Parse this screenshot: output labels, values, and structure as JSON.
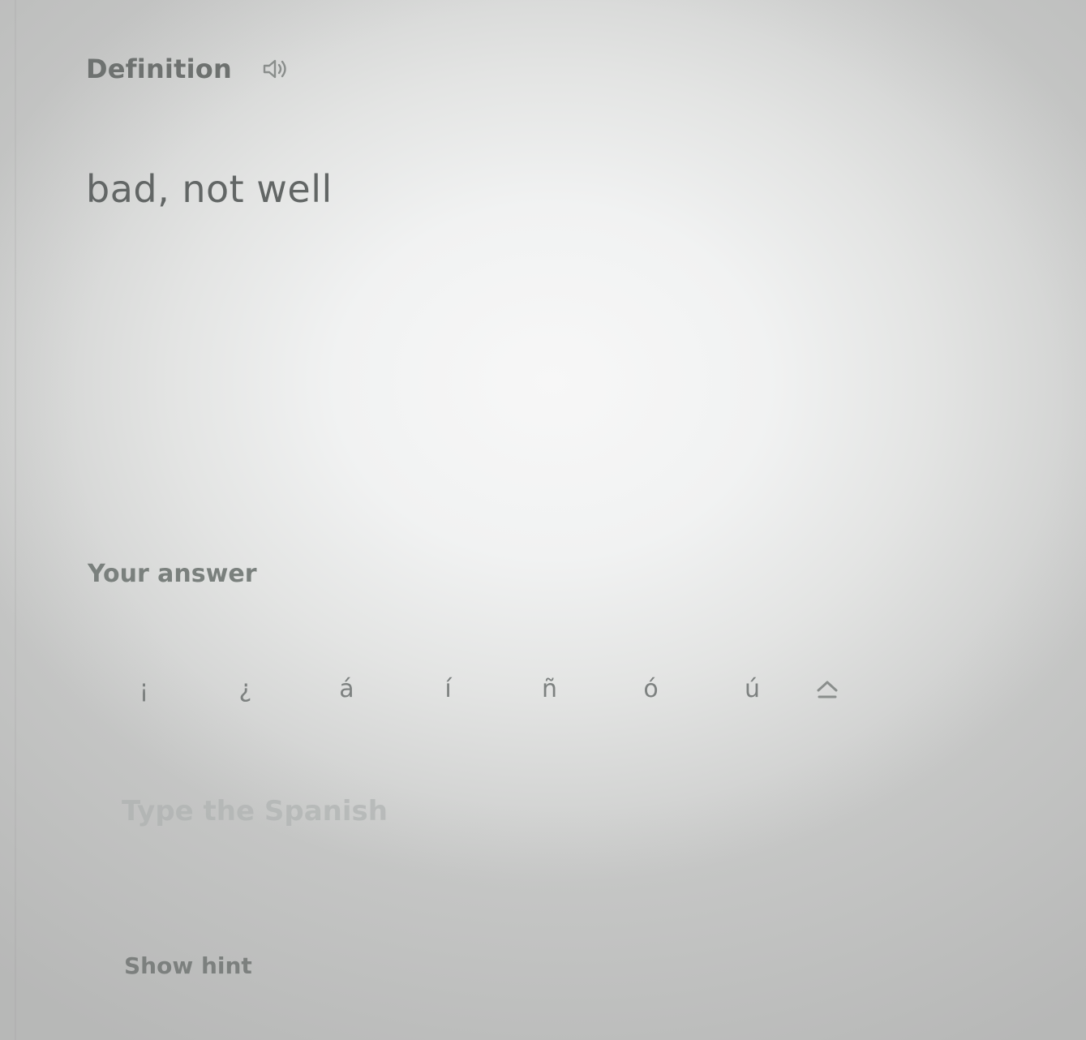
{
  "definition": {
    "label": "Definition",
    "audio_icon": "speaker-icon",
    "text": "bad, not well"
  },
  "answer": {
    "label": "Your answer",
    "placeholder": "Type the Spanish",
    "value": ""
  },
  "accents": {
    "keys": [
      "¡",
      "¿",
      "á",
      "í",
      "ñ",
      "ó",
      "ú"
    ],
    "shift_icon": "shift-caret-icon"
  },
  "hint": {
    "label": "Show hint"
  }
}
